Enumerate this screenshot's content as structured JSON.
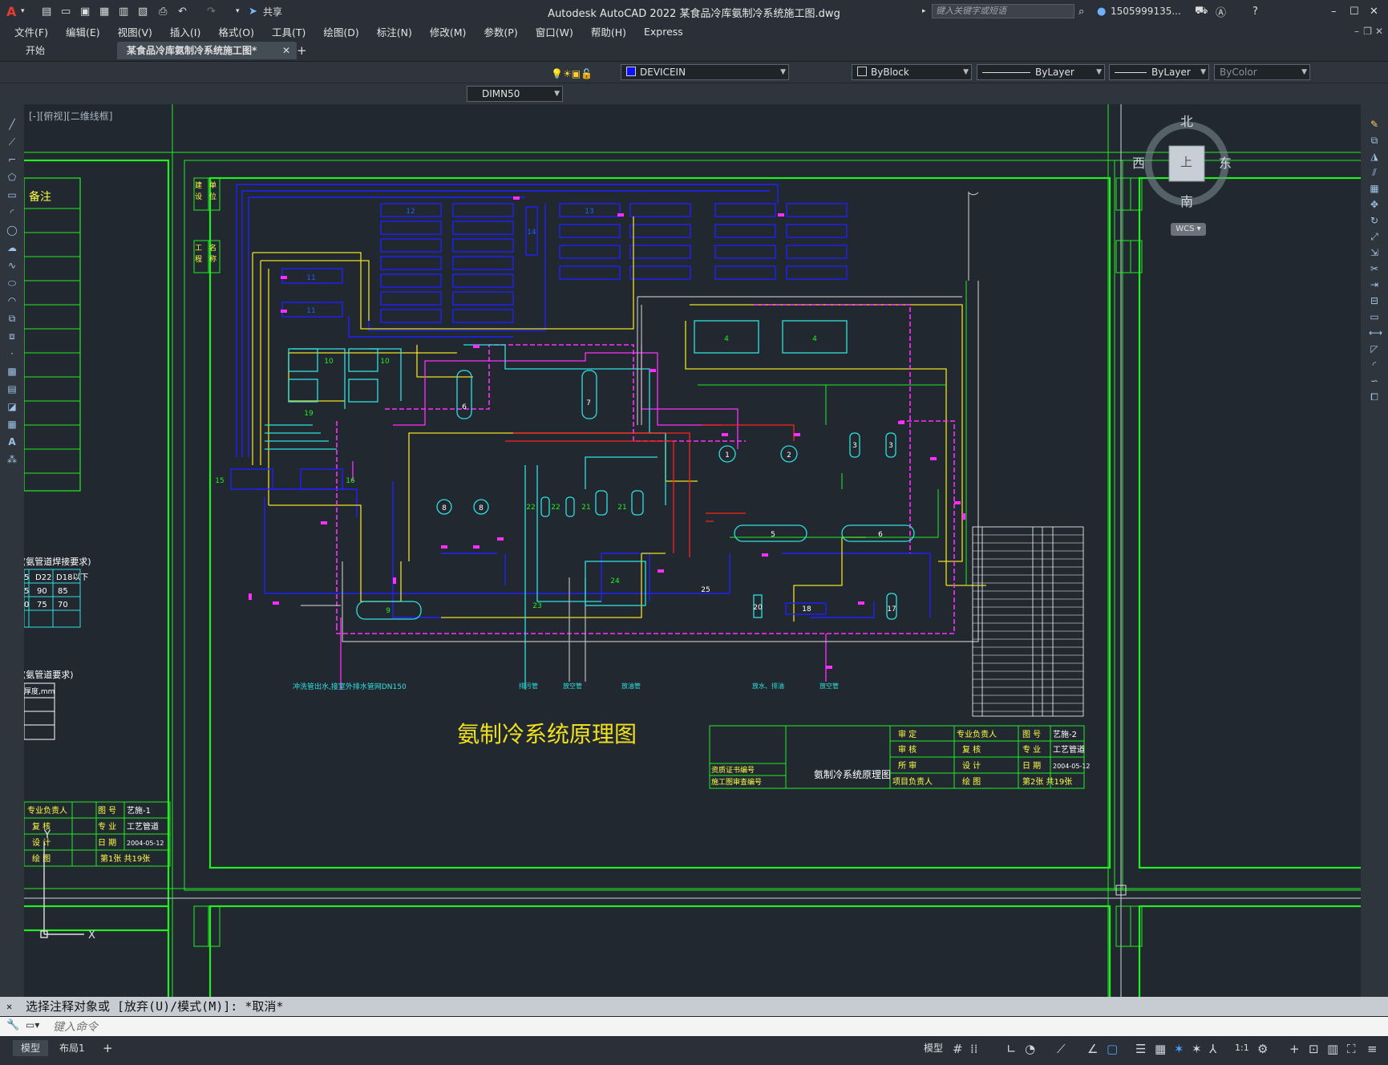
{
  "app": {
    "logo": "A",
    "title": "Autodesk AutoCAD 2022    某食品冷库氨制冷系统施工图.dwg",
    "share_label": "共享",
    "search_placeholder": "键入关键字或短语",
    "user": "1505999135...",
    "colors": {
      "title_bg": "#2b3038",
      "canvas_bg": "#212830",
      "frame_green": "#22ee22",
      "pipe_blue": "#2020ff",
      "pipe_yellow": "#f0e020",
      "pipe_magenta": "#ff30ff",
      "pipe_cyan": "#30e0e0",
      "pipe_red": "#ff2020"
    }
  },
  "menu": [
    "文件(F)",
    "编辑(E)",
    "视图(V)",
    "插入(I)",
    "格式(O)",
    "工具(T)",
    "绘图(D)",
    "标注(N)",
    "修改(M)",
    "参数(P)",
    "窗口(W)",
    "帮助(H)",
    "Express"
  ],
  "tabs": [
    {
      "label": "开始",
      "active": false
    },
    {
      "label": "某食品冷库氨制冷系统施工图*",
      "active": true
    }
  ],
  "toolbar": {
    "layer": "DEVICEIN",
    "color": "ByBlock",
    "linetype": "ByLayer",
    "lineweight": "ByLayer",
    "plotstyle": "ByColor",
    "dimstyle": "DIMN50"
  },
  "viewport": {
    "label": "[-][俯视][二维线框]"
  },
  "viewcube": {
    "north": "北",
    "south": "南",
    "east": "东",
    "west": "西",
    "face": "上",
    "wcs": "WCS"
  },
  "drawing": {
    "title": "氨制冷系统原理图",
    "note": "备注",
    "left_table_title": "(氨管道焊接要求)",
    "left_table_row1": [
      "5",
      "D22",
      "D18以下"
    ],
    "left_table_row2": [
      "5",
      "90",
      "85"
    ],
    "left_table_row3": [
      "0",
      "75",
      "70"
    ],
    "left_table2_title": "(氨管道要求)",
    "left_table2_head": "厚度,mm",
    "pipe_note": "冲洗管出水,接室外排水管网DN150",
    "outlets": [
      "排污管",
      "放空管",
      "放油管",
      "放水、排油",
      "放空管"
    ],
    "block_left": {
      "rows": [
        [
          "专业负责人",
          "图 号",
          "艺施-1"
        ],
        [
          "复 核",
          "专 业",
          "工艺管道"
        ],
        [
          "设 计",
          "日 期",
          "2004-05-12"
        ],
        [
          "绘 图",
          "第1张 共19张",
          ""
        ]
      ]
    },
    "block_right": {
      "name": "氨制冷系统原理图",
      "cert": "资质证书编号",
      "review": "施工图审查编号",
      "rows": [
        [
          "审 定",
          "专业负责人",
          "图 号",
          "艺施-2"
        ],
        [
          "审 核",
          "复 核",
          "专 业",
          "工艺管道"
        ],
        [
          "所 审",
          "设 计",
          "日 期",
          "2004-05-12"
        ],
        [
          "项目负责人",
          "绘 图",
          "第2张 共19张",
          ""
        ]
      ]
    },
    "equipment_numbers": [
      "1",
      "2",
      "3",
      "3",
      "4",
      "4",
      "5",
      "6",
      "6",
      "7",
      "8",
      "8",
      "9",
      "10",
      "10",
      "11",
      "11",
      "12",
      "13",
      "14",
      "15",
      "16",
      "17",
      "18",
      "19",
      "20",
      "21",
      "21",
      "22",
      "22",
      "23",
      "24",
      "25"
    ],
    "strip_labels": [
      "建",
      "设",
      "单",
      "位",
      "工",
      "程",
      "名",
      "称"
    ]
  },
  "command": {
    "history": "选择注释对象或 [放弃(U)/模式(M)]: *取消*",
    "placeholder": "键入命令"
  },
  "status": {
    "model_tab": "模型",
    "layout_tab": "布局1",
    "model_label": "模型",
    "scale": "1:1"
  }
}
